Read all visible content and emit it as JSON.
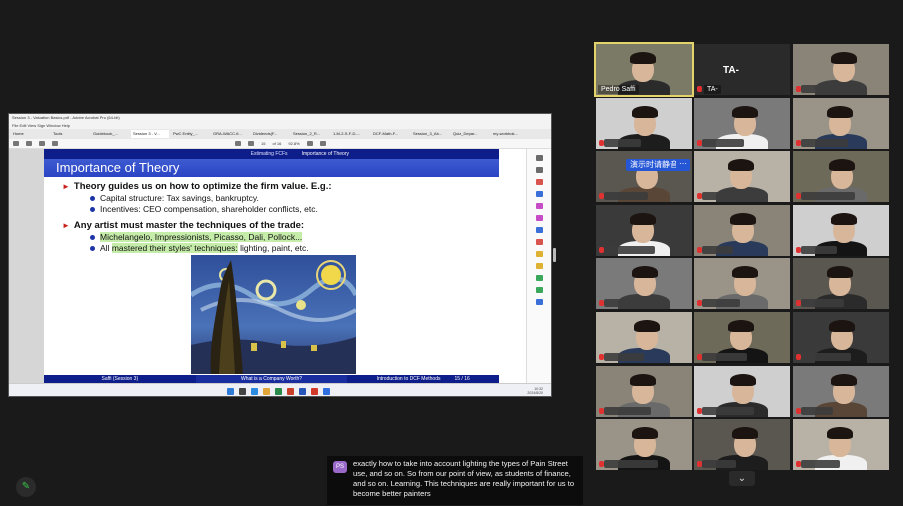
{
  "pdf": {
    "window_title": "Session 3 - Valuation Basics.pdf - Adobe Acrobat Pro (64-bit)",
    "menu": "File  Edit  View  Sign  Window  Help",
    "tabs": [
      "Home",
      "Tools",
      "Guidebook_...",
      "Session 3 - V...",
      "PwC Entity_...",
      "GRA-WACC-fi...",
      "Dividends(F...",
      "Session_2_R...",
      "1-M-2-S-F-D-...",
      "DCF-Math-F...",
      "Session_3_Ab...",
      "Quiz_Depar...",
      "my-workbok..."
    ],
    "active_tab_index": 3,
    "page_field": "15",
    "page_count": "of 16",
    "zoom": "92.8%"
  },
  "slide": {
    "nav_items": [
      "Estimating FCFs",
      "Importance of Theory"
    ],
    "title": "Importance of Theory",
    "bullet1": "Theory guides us on how to optimize the firm value. E.g.:",
    "sub1a": "Capital structure: Tax savings, bankruptcy.",
    "sub1b": "Incentives: CEO compensation, shareholder conflicts, etc.",
    "bullet2": "Any artist must master the techniques of the trade:",
    "sub2a": "Michelangelo, Impressionists, Picasso, Dali, Pollock...",
    "sub2b_pre": "All ",
    "sub2b_hl": "mastered their styles' techniques:",
    "sub2b_post": " lighting, paint, etc.",
    "footer_left": "Saffi (Session 3)",
    "footer_mid": "What is a Company Worth?",
    "footer_right": "Introduction to DCF Methods",
    "page": "15 / 16"
  },
  "taskbar": {
    "time": "10:32",
    "date": "2024/8/20"
  },
  "participants": {
    "host_name": "Pedro Saffi",
    "ta_label": "TA-",
    "ta_small": "TA-",
    "chinese_tag": "演示时请静音"
  },
  "caption": {
    "avatar": "PS",
    "text": "exactly how to take into account lighting the types of Pain Street use, and so on. So from our point of view, as students of finance, and so on. Learning. This techniques are really important for us to become better painters"
  },
  "colors": {
    "slide_blue": "#2a44c4",
    "nav_blue": "#0d1d8a",
    "highlight": "#c6ecaa",
    "active_speaker": "#e3d36a",
    "muted_red": "#e03030"
  }
}
